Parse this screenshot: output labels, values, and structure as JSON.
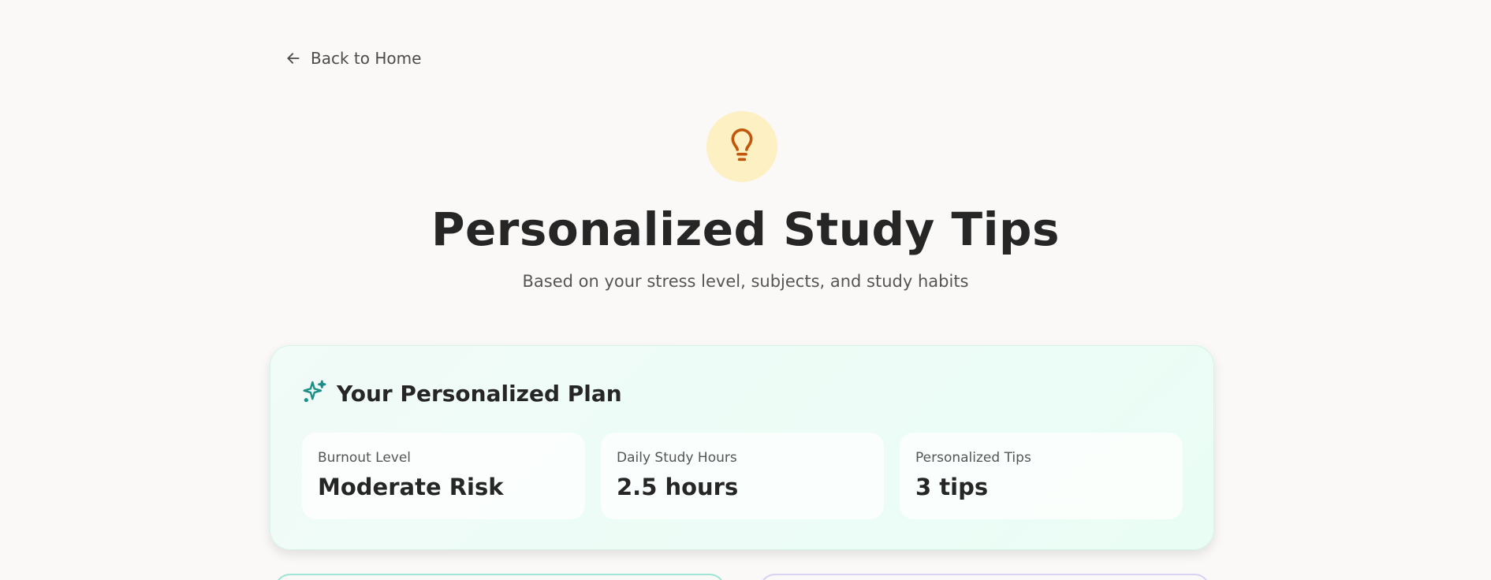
{
  "nav": {
    "back_label": "Back to Home",
    "back_icon": "arrow-left-icon"
  },
  "hero": {
    "icon": "lightbulb-icon",
    "title": "Personalized Study Tips",
    "subtitle": "Based on your stress level, subjects, and study habits"
  },
  "plan": {
    "icon": "sparkles-icon",
    "title": "Your Personalized Plan",
    "stats": [
      {
        "label": "Burnout Level",
        "value": "Moderate Risk"
      },
      {
        "label": "Daily Study Hours",
        "value": "2.5 hours"
      },
      {
        "label": "Personalized Tips",
        "value": "3 tips"
      }
    ]
  },
  "colors": {
    "background": "#faf9f7",
    "accent_teal": "#1a8f8a",
    "icon_bg": "#fdf0c2",
    "icon_fg": "#c2570c"
  }
}
